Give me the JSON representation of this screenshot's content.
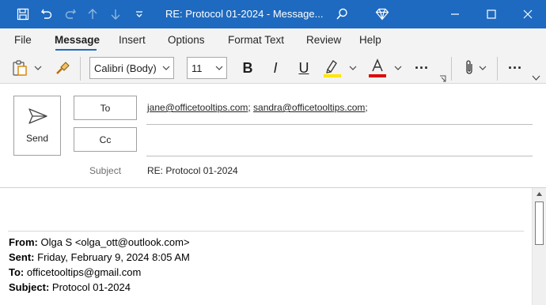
{
  "window": {
    "title": "RE: Protocol 01-2024  -  Message...",
    "colors": {
      "titlebar": "#1e6ac0",
      "accent": "#1e6ac0"
    }
  },
  "menu": {
    "tabs": [
      {
        "label": "File"
      },
      {
        "label": "Message"
      },
      {
        "label": "Insert"
      },
      {
        "label": "Options"
      },
      {
        "label": "Format Text"
      },
      {
        "label": "Review"
      },
      {
        "label": "Help"
      }
    ],
    "active": "Message"
  },
  "ribbon": {
    "font_name": "Calibri (Body)",
    "font_size": "11",
    "bold": "B",
    "italic": "I",
    "underline": "U",
    "highlight_color": "#ffe600",
    "font_color": "#e00000",
    "more": "···"
  },
  "header": {
    "send_label": "Send",
    "to_label": "To",
    "cc_label": "Cc",
    "to_recipients": [
      "jane@officetooltips.com",
      "sandra@officetooltips.com"
    ],
    "cc_value": "",
    "subject_label": "Subject",
    "subject_value": "RE: Protocol 01-2024"
  },
  "quoted": {
    "from_label": "From:",
    "from_value": "Olga S <olga_ott@outlook.com>",
    "sent_label": "Sent:",
    "sent_value": "Friday, February 9, 2024 8:05 AM",
    "to_label": "To:",
    "to_value": "officetooltips@gmail.com",
    "subject_label": "Subject:",
    "subject_value": "Protocol 01-2024"
  }
}
